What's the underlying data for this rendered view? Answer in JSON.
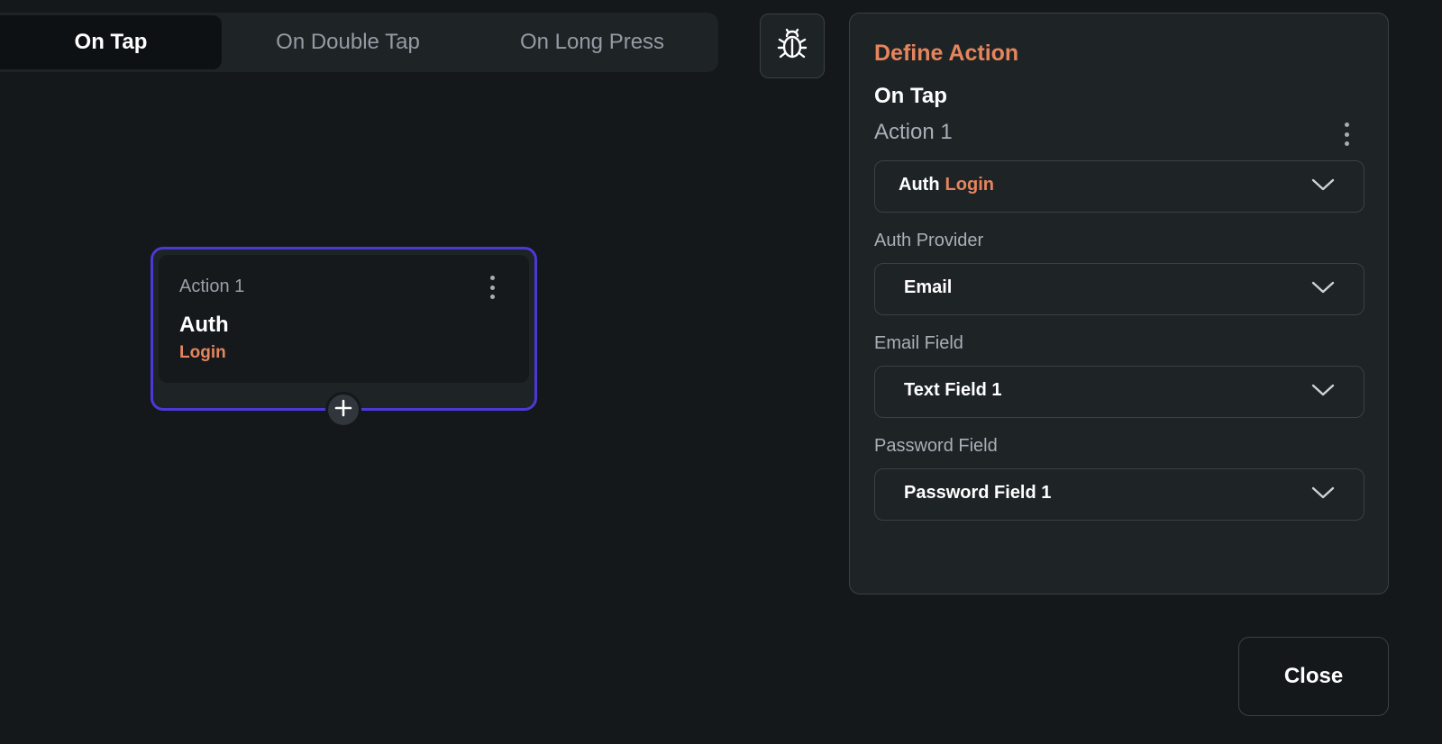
{
  "tabs": [
    {
      "label": "On Tap",
      "active": true
    },
    {
      "label": "On Double Tap",
      "active": false
    },
    {
      "label": "On Long Press",
      "active": false
    }
  ],
  "debug_icon": "bug-icon",
  "node": {
    "label": "Action 1",
    "type": "Auth",
    "subtype": "Login",
    "menu_icon": "more-vertical-icon",
    "add_icon": "plus-icon"
  },
  "panel": {
    "title": "Define Action",
    "trigger": "On Tap",
    "action_label": "Action 1",
    "action_select": {
      "category": "Auth",
      "value": "Login"
    },
    "fields": [
      {
        "label": "Auth Provider",
        "value": "Email"
      },
      {
        "label": "Email Field",
        "value": "Text Field 1"
      },
      {
        "label": "Password Field",
        "value": "Password Field 1"
      }
    ]
  },
  "close_label": "Close",
  "colors": {
    "accent": "#e5855c",
    "selection": "#4b39d6",
    "background": "#14181b",
    "surface": "#1e2326"
  }
}
